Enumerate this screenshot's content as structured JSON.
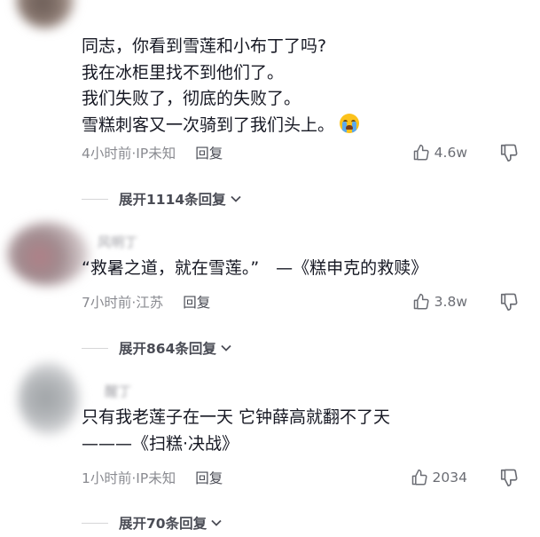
{
  "comments": [
    {
      "lines": [
        "同志，你看到雪莲和小布丁了吗?",
        "我在冰柜里找不到他们了。",
        "我们失败了，彻底的失败了。",
        "雪糕刺客又一次骑到了我们头上。"
      ],
      "emoji": "loudly-crying-face-emoji",
      "time": "4小时前·IP未知",
      "reply": "回复",
      "likes": "4.6w",
      "expand": "展开1114条回复"
    },
    {
      "username": "风明丁",
      "lines": [
        "“救暑之道，就在雪莲。”　—《糕申克的救赎》"
      ],
      "time": "7小时前·江苏",
      "reply": "回复",
      "likes": "3.8w",
      "expand": "展开864条回复"
    },
    {
      "username": "醒丁",
      "lines": [
        "只有我老莲子在一天 它钟薛高就翻不了天",
        "———《扫糕·决战》"
      ],
      "time": "1小时前·IP未知",
      "reply": "回复",
      "likes": "2034",
      "expand": "展开70条回复"
    }
  ],
  "colors": {
    "text": "#161823",
    "meta": "#8a8b91",
    "reply": "#4a4c55",
    "divider": "#d6d6d8",
    "emoji_face": "#fcc21b",
    "emoji_tear": "#5aa8ec"
  },
  "icons": [
    "thumbs-up-icon",
    "thumbs-down-icon",
    "chevron-down-icon"
  ]
}
